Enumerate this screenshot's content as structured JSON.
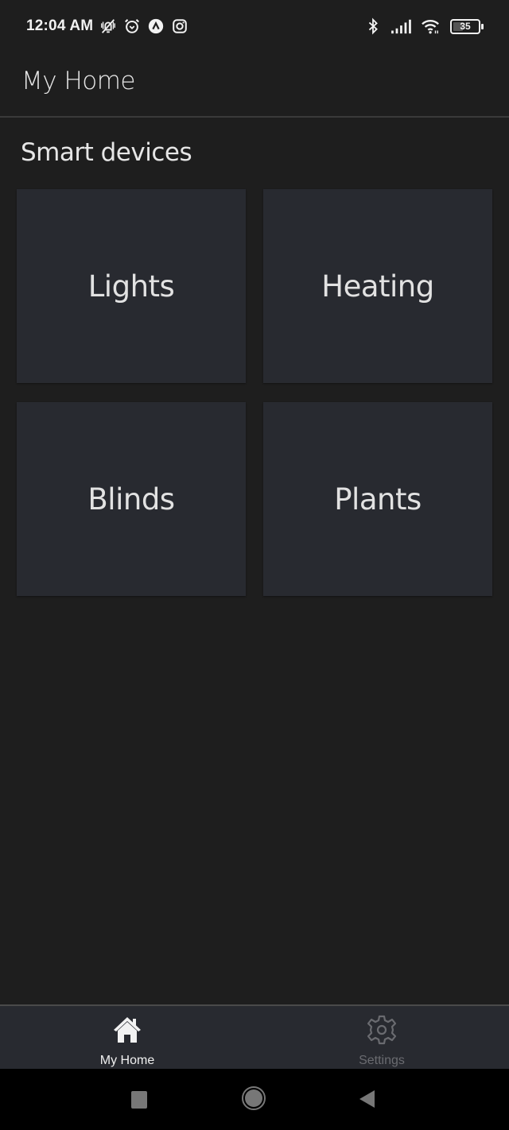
{
  "status_bar": {
    "time": "12:04 AM",
    "left_icons": [
      "vibrate-silent-icon",
      "alarm-icon",
      "app-notification-icon",
      "instagram-icon"
    ],
    "right_icons": [
      "bluetooth-icon",
      "signal-icon",
      "wifi-icon",
      "battery-icon"
    ],
    "battery_level": "35"
  },
  "header": {
    "title": "My Home"
  },
  "section": {
    "title": "Smart devices"
  },
  "devices": [
    {
      "label": "Lights"
    },
    {
      "label": "Heating"
    },
    {
      "label": "Blinds"
    },
    {
      "label": "Plants"
    }
  ],
  "bottom_nav": {
    "items": [
      {
        "label": "My Home",
        "icon": "home-icon",
        "active": true
      },
      {
        "label": "Settings",
        "icon": "gear-icon",
        "active": false
      }
    ]
  },
  "system_nav": {
    "buttons": [
      "recents",
      "home",
      "back"
    ]
  },
  "colors": {
    "background": "#1e1e1e",
    "tile": "#282a30",
    "nav_active": "#f0f0f0",
    "nav_inactive": "#6a6b70"
  }
}
